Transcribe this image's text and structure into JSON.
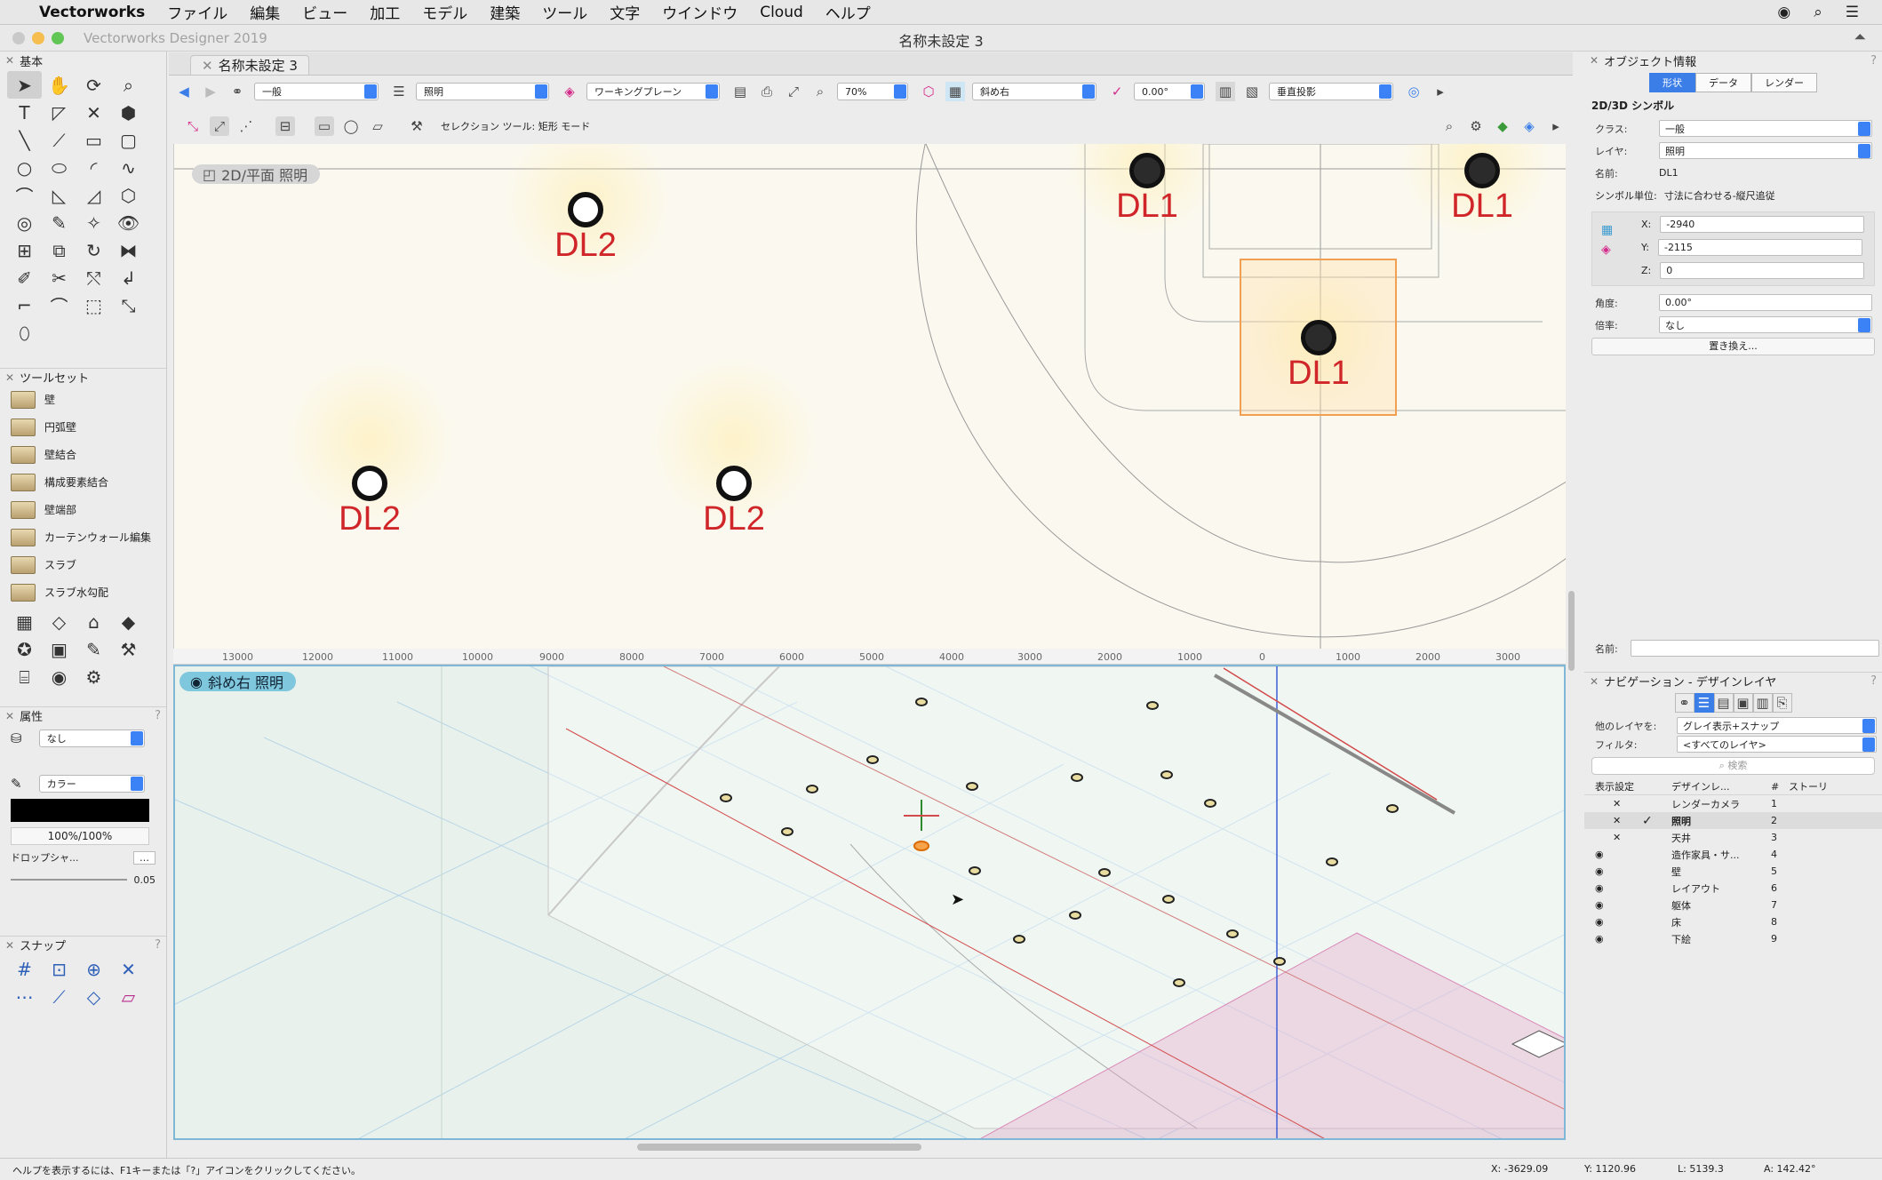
{
  "menubar": {
    "app": "Vectorworks",
    "items": [
      "ファイル",
      "編集",
      "ビュー",
      "加工",
      "モデル",
      "建築",
      "ツール",
      "文字",
      "ウインドウ",
      "Cloud",
      "ヘルプ"
    ]
  },
  "window": {
    "app_title": "Vectorworks Designer 2019",
    "doc_title": "名称未設定 3",
    "tab": "名称未設定 3"
  },
  "toolbar1": {
    "class": "一般",
    "layer": "照明",
    "plane": "ワーキングプレーン",
    "zoom": "70%",
    "view": "斜め右",
    "angle": "0.00°",
    "projection": "垂直投影"
  },
  "toolbar2": {
    "mode_text": "セレクション ツール: 矩形 モード"
  },
  "left": {
    "basic_title": "基本",
    "toolset_title": "ツールセット",
    "toolset": [
      "壁",
      "円弧壁",
      "壁結合",
      "構成要素結合",
      "壁端部",
      "カーテンウォール編集",
      "スラブ",
      "スラブ水勾配"
    ],
    "attr_title": "属性",
    "fill": "なし",
    "pen": "カラー",
    "opacity": "100%/100%",
    "drop_shadow": "ドロップシャ...",
    "line_weight": "0.05",
    "snap_title": "スナップ"
  },
  "top_view": {
    "tag": "2D/平面  照明",
    "lights": [
      {
        "label": "DL2",
        "type": "open"
      },
      {
        "label": "DL1",
        "type": "filled"
      },
      {
        "label": "DL1",
        "type": "filled"
      },
      {
        "label": "DL1",
        "type": "filled"
      },
      {
        "label": "DL2",
        "type": "open"
      },
      {
        "label": "DL2",
        "type": "open"
      }
    ]
  },
  "iso_view": {
    "tag": "斜め右  照明"
  },
  "ruler": [
    "13000",
    "12000",
    "11000",
    "10000",
    "9000",
    "8000",
    "7000",
    "6000",
    "5000",
    "4000",
    "3000",
    "2000",
    "1000",
    "0",
    "1000",
    "2000",
    "3000"
  ],
  "obj_info": {
    "title": "オブジェクト情報",
    "tabs": [
      "形状",
      "データ",
      "レンダー"
    ],
    "heading": "2D/3D シンボル",
    "class_label": "クラス:",
    "class": "一般",
    "layer_label": "レイヤ:",
    "layer": "照明",
    "name_label": "名前:",
    "name": "DL1",
    "unit_label": "シンボル単位:",
    "unit": "寸法に合わせる-縦尺追従",
    "x": "-2940",
    "y": "-2115",
    "z": "0",
    "angle_label": "角度:",
    "angle": "0.00°",
    "scale_label": "倍率:",
    "scale": "なし",
    "replace": "置き換え...",
    "name2_label": "名前:"
  },
  "navigation": {
    "title": "ナビゲーション - デザインレイヤ",
    "other_label": "他のレイヤを:",
    "other": "グレイ表示+スナップ",
    "filter_label": "フィルタ:",
    "filter": "<すべてのレイヤ>",
    "search": "検索",
    "cols": [
      "表示設定",
      "デザインレ...",
      "#",
      "ストーリ"
    ],
    "layers": [
      {
        "vis": "✕",
        "name": "レンダーカメラ",
        "num": "1",
        "active": false
      },
      {
        "vis": "✕",
        "name": "照明",
        "num": "2",
        "active": true
      },
      {
        "vis": "✕",
        "name": "天井",
        "num": "3",
        "active": false
      },
      {
        "vis": "◉",
        "name": "造作家具・サ...",
        "num": "4",
        "active": false
      },
      {
        "vis": "◉",
        "name": "壁",
        "num": "5",
        "active": false
      },
      {
        "vis": "◉",
        "name": "レイアウト",
        "num": "6",
        "active": false
      },
      {
        "vis": "◉",
        "name": "躯体",
        "num": "7",
        "active": false
      },
      {
        "vis": "◉",
        "name": "床",
        "num": "8",
        "active": false
      },
      {
        "vis": "◉",
        "name": "下絵",
        "num": "9",
        "active": false
      }
    ]
  },
  "status": {
    "help": "ヘルプを表示するには、F1キーまたは「?」アイコンをクリックしてください。",
    "x": "X: -3629.09",
    "y": "Y: 1120.96",
    "l": "L: 5139.3",
    "a": "A: 142.42°"
  }
}
